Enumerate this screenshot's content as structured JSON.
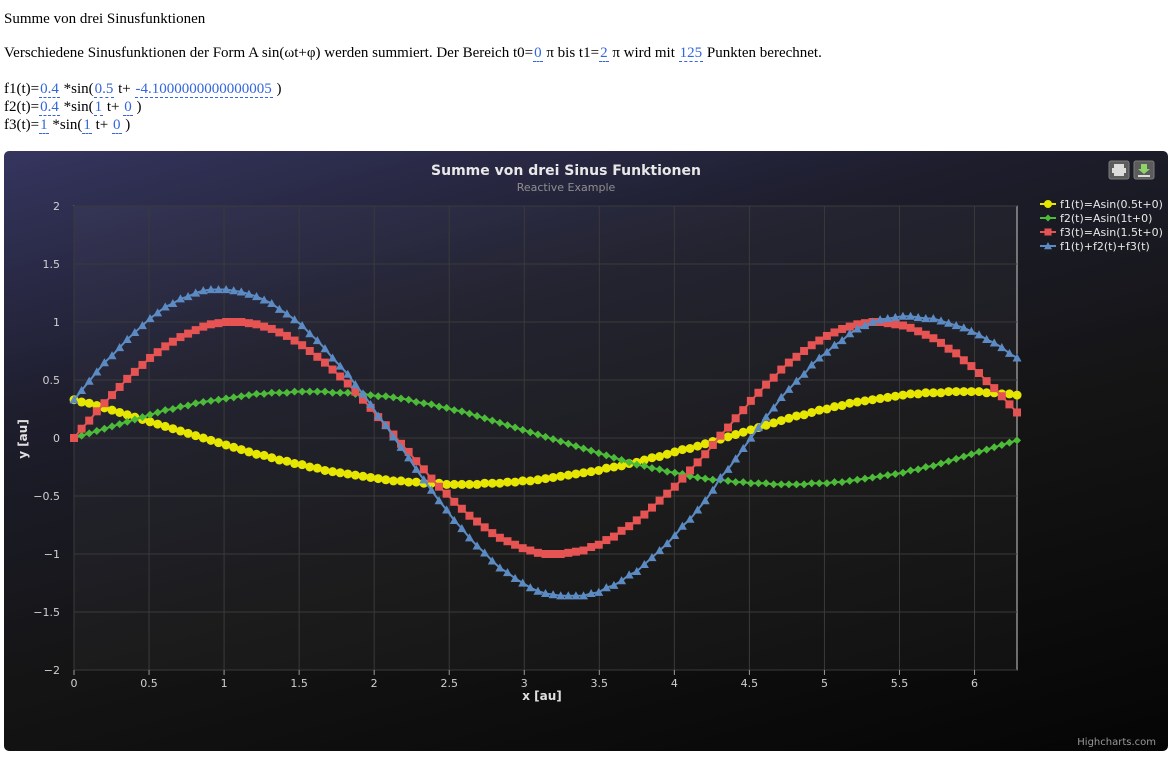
{
  "page": {
    "heading": "Summe von drei Sinusfunktionen",
    "desc": {
      "part1": "Verschiedene Sinusfunktionen der Form A sin(ωt+φ) werden summiert. Der Bereich t0=",
      "t0": "0",
      "part2": " π bis t1=",
      "t1": "2",
      "part3": " π wird mit ",
      "points": "125",
      "part4": " Punkten berechnet."
    },
    "formulas": [
      {
        "prefix": "f1(t)=",
        "A": "0.4",
        "mid": " *sin(",
        "w": "0.5",
        "tplus": " t+ ",
        "phi": "-4.1000000000000005",
        "end": " )"
      },
      {
        "prefix": "f2(t)=",
        "A": "0.4",
        "mid": " *sin(",
        "w": "1",
        "tplus": " t+ ",
        "phi": "0",
        "end": " )"
      },
      {
        "prefix": "f3(t)=",
        "A": "1",
        "mid": " *sin(",
        "w": "1",
        "tplus": " t+ ",
        "phi": "0",
        "end": " )"
      }
    ]
  },
  "chart": {
    "icons": [
      "print-icon",
      "download-icon"
    ],
    "credits": "Highcharts.com"
  },
  "chart_data": {
    "type": "line",
    "title": "Summe von drei Sinus Funktionen",
    "subtitle": "Reactive Example",
    "xlabel": "x [au]",
    "ylabel": "y [au]",
    "xlim": [
      0,
      6.283
    ],
    "ylim": [
      -2,
      2
    ],
    "x_ticks": [
      0,
      0.5,
      1,
      1.5,
      2,
      2.5,
      3,
      3.5,
      4,
      4.5,
      5,
      5.5,
      6
    ],
    "y_ticks": [
      -2,
      -1.5,
      -1,
      -0.5,
      0,
      0.5,
      1,
      1.5,
      2
    ],
    "y_tick_labels": [
      "−2",
      "−1.5",
      "−1",
      "−0.5",
      "0",
      "0.5",
      "1",
      "1.5",
      "2"
    ],
    "grid": true,
    "legend_position": "right",
    "num_points": 125,
    "x_range": [
      0,
      6.2832
    ],
    "series": [
      {
        "name": "f1(t)=Asin(0.5t+0)",
        "color": "#e6e600",
        "marker": "circle",
        "values": [
          0.33,
          0.31,
          0.3,
          0.28,
          0.26,
          0.24,
          0.22,
          0.2,
          0.18,
          0.16,
          0.14,
          0.12,
          0.1,
          0.08,
          0.06,
          0.04,
          0.02,
          0.0,
          -0.02,
          -0.04,
          -0.06,
          -0.08,
          -0.1,
          -0.12,
          -0.14,
          -0.15,
          -0.17,
          -0.19,
          -0.2,
          -0.22,
          -0.23,
          -0.25,
          -0.26,
          -0.28,
          -0.29,
          -0.3,
          -0.31,
          -0.32,
          -0.33,
          -0.34,
          -0.35,
          -0.36,
          -0.37,
          -0.37,
          -0.38,
          -0.38,
          -0.39,
          -0.39,
          -0.39,
          -0.4,
          -0.4,
          -0.4,
          -0.4,
          -0.4,
          -0.39,
          -0.39,
          -0.39,
          -0.38,
          -0.38,
          -0.37,
          -0.37,
          -0.36,
          -0.35,
          -0.34,
          -0.33,
          -0.32,
          -0.31,
          -0.3,
          -0.29,
          -0.28,
          -0.26,
          -0.25,
          -0.24,
          -0.22,
          -0.21,
          -0.19,
          -0.17,
          -0.16,
          -0.14,
          -0.12,
          -0.1,
          -0.09,
          -0.07,
          -0.05,
          -0.03,
          -0.01,
          0.01,
          0.03,
          0.05,
          0.07,
          0.09,
          0.11,
          0.13,
          0.15,
          0.17,
          0.19,
          0.2,
          0.22,
          0.24,
          0.25,
          0.27,
          0.28,
          0.3,
          0.31,
          0.32,
          0.33,
          0.34,
          0.35,
          0.36,
          0.37,
          0.38,
          0.38,
          0.39,
          0.39,
          0.39,
          0.4,
          0.4,
          0.4,
          0.4,
          0.4,
          0.39,
          0.39,
          0.38,
          0.38,
          0.37
        ]
      },
      {
        "name": "f2(t)=Asin(1t+0)",
        "color": "#4cbb38",
        "marker": "diamond",
        "values": [
          0.0,
          0.02,
          0.04,
          0.06,
          0.08,
          0.1,
          0.12,
          0.14,
          0.16,
          0.18,
          0.2,
          0.22,
          0.24,
          0.25,
          0.27,
          0.28,
          0.3,
          0.31,
          0.32,
          0.33,
          0.34,
          0.35,
          0.36,
          0.37,
          0.38,
          0.38,
          0.39,
          0.39,
          0.39,
          0.4,
          0.4,
          0.4,
          0.4,
          0.4,
          0.39,
          0.39,
          0.39,
          0.38,
          0.38,
          0.37,
          0.36,
          0.36,
          0.35,
          0.34,
          0.33,
          0.31,
          0.3,
          0.29,
          0.27,
          0.26,
          0.24,
          0.23,
          0.21,
          0.19,
          0.17,
          0.15,
          0.13,
          0.11,
          0.09,
          0.07,
          0.05,
          0.03,
          0.01,
          -0.01,
          -0.03,
          -0.05,
          -0.07,
          -0.09,
          -0.11,
          -0.13,
          -0.15,
          -0.17,
          -0.19,
          -0.21,
          -0.23,
          -0.24,
          -0.26,
          -0.27,
          -0.29,
          -0.3,
          -0.31,
          -0.33,
          -0.34,
          -0.35,
          -0.36,
          -0.36,
          -0.37,
          -0.38,
          -0.38,
          -0.39,
          -0.39,
          -0.39,
          -0.4,
          -0.4,
          -0.4,
          -0.4,
          -0.4,
          -0.39,
          -0.39,
          -0.39,
          -0.38,
          -0.38,
          -0.37,
          -0.36,
          -0.35,
          -0.34,
          -0.33,
          -0.32,
          -0.31,
          -0.3,
          -0.28,
          -0.27,
          -0.25,
          -0.24,
          -0.22,
          -0.2,
          -0.18,
          -0.16,
          -0.14,
          -0.12,
          -0.1,
          -0.08,
          -0.06,
          -0.04,
          -0.02
        ]
      },
      {
        "name": "f3(t)=Asin(1.5t+0)",
        "color": "#e55353",
        "marker": "square",
        "values": [
          0.0,
          0.08,
          0.15,
          0.23,
          0.3,
          0.37,
          0.44,
          0.51,
          0.57,
          0.63,
          0.69,
          0.74,
          0.79,
          0.83,
          0.87,
          0.9,
          0.93,
          0.96,
          0.98,
          0.99,
          1.0,
          1.0,
          1.0,
          0.99,
          0.98,
          0.96,
          0.94,
          0.91,
          0.88,
          0.84,
          0.8,
          0.75,
          0.7,
          0.65,
          0.59,
          0.53,
          0.47,
          0.4,
          0.33,
          0.26,
          0.18,
          0.11,
          0.03,
          -0.05,
          -0.12,
          -0.2,
          -0.27,
          -0.35,
          -0.42,
          -0.48,
          -0.55,
          -0.61,
          -0.67,
          -0.72,
          -0.77,
          -0.82,
          -0.86,
          -0.89,
          -0.92,
          -0.95,
          -0.97,
          -0.99,
          -1.0,
          -1.0,
          -1.0,
          -0.99,
          -0.98,
          -0.97,
          -0.94,
          -0.92,
          -0.88,
          -0.85,
          -0.8,
          -0.76,
          -0.71,
          -0.66,
          -0.6,
          -0.54,
          -0.48,
          -0.42,
          -0.35,
          -0.28,
          -0.21,
          -0.14,
          -0.06,
          0.02,
          0.09,
          0.17,
          0.24,
          0.32,
          0.39,
          0.46,
          0.52,
          0.59,
          0.65,
          0.7,
          0.75,
          0.8,
          0.84,
          0.88,
          0.91,
          0.94,
          0.96,
          0.98,
          0.99,
          1.0,
          1.0,
          0.99,
          0.98,
          0.97,
          0.95,
          0.92,
          0.89,
          0.86,
          0.82,
          0.77,
          0.73,
          0.67,
          0.62,
          0.56,
          0.49,
          0.43,
          0.36,
          0.29,
          0.22
        ]
      },
      {
        "name": "f1(t)+f2(t)+f3(t)",
        "color": "#5b8bc2",
        "marker": "triangle",
        "values": [
          0.33,
          0.41,
          0.49,
          0.57,
          0.65,
          0.71,
          0.78,
          0.85,
          0.91,
          0.97,
          1.03,
          1.08,
          1.13,
          1.16,
          1.2,
          1.22,
          1.25,
          1.27,
          1.28,
          1.28,
          1.28,
          1.27,
          1.26,
          1.24,
          1.22,
          1.19,
          1.16,
          1.11,
          1.07,
          1.02,
          0.97,
          0.9,
          0.84,
          0.77,
          0.69,
          0.62,
          0.55,
          0.46,
          0.38,
          0.29,
          0.19,
          0.11,
          0.01,
          -0.08,
          -0.17,
          -0.27,
          -0.36,
          -0.45,
          -0.54,
          -0.62,
          -0.71,
          -0.78,
          -0.86,
          -0.93,
          -0.99,
          -1.06,
          -1.12,
          -1.16,
          -1.21,
          -1.25,
          -1.29,
          -1.32,
          -1.34,
          -1.35,
          -1.36,
          -1.36,
          -1.36,
          -1.36,
          -1.34,
          -1.33,
          -1.29,
          -1.27,
          -1.23,
          -1.18,
          -1.15,
          -1.09,
          -1.03,
          -0.97,
          -0.91,
          -0.84,
          -0.76,
          -0.7,
          -0.62,
          -0.54,
          -0.45,
          -0.34,
          -0.27,
          -0.18,
          -0.09,
          0.0,
          0.09,
          0.18,
          0.26,
          0.35,
          0.42,
          0.49,
          0.55,
          0.63,
          0.69,
          0.74,
          0.8,
          0.84,
          0.9,
          0.94,
          0.97,
          1.0,
          1.02,
          1.03,
          1.04,
          1.05,
          1.05,
          1.04,
          1.03,
          1.03,
          1.01,
          0.99,
          0.97,
          0.95,
          0.92,
          0.89,
          0.85,
          0.82,
          0.78,
          0.73,
          0.69
        ]
      }
    ]
  }
}
